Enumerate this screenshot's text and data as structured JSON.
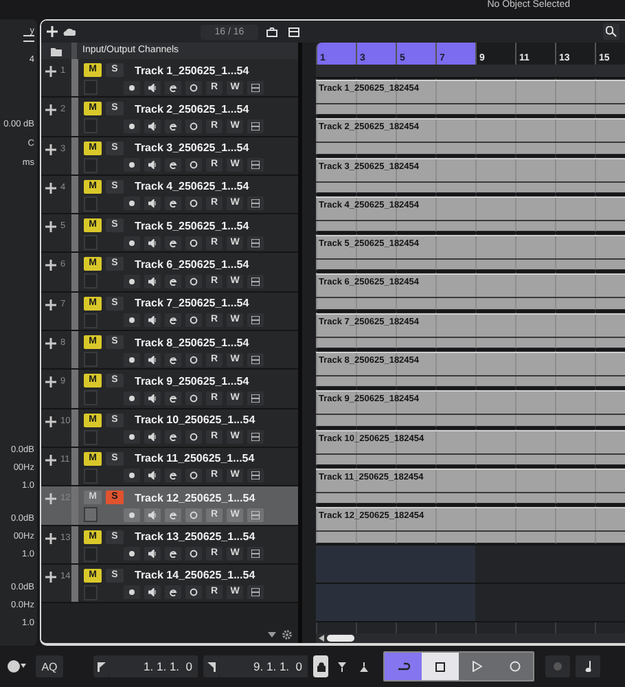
{
  "top_bar": {
    "status": "No Object Selected"
  },
  "inspector_fragments": [
    "y",
    "4",
    "0.00 dB",
    "C",
    "ms",
    "0.0dB",
    "00Hz",
    "1.0",
    "0.0dB",
    "00Hz",
    "1.0",
    "0.0dB",
    "0.0Hz",
    "1.0"
  ],
  "toolbar": {
    "track_count": "16 / 16"
  },
  "folder": {
    "label": "Input/Output Channels"
  },
  "tracks": [
    {
      "number": "1",
      "name": "Track 1_250625_1...54",
      "mute_label": "M",
      "solo_label": "S",
      "read_label": "R",
      "write_label": "W",
      "muted": true,
      "soloed": false,
      "selected": false,
      "clip": "Track 1_250625_182454"
    },
    {
      "number": "2",
      "name": "Track 2_250625_1...54",
      "mute_label": "M",
      "solo_label": "S",
      "read_label": "R",
      "write_label": "W",
      "muted": true,
      "soloed": false,
      "selected": false,
      "clip": "Track 2_250625_182454"
    },
    {
      "number": "3",
      "name": "Track 3_250625_1...54",
      "mute_label": "M",
      "solo_label": "S",
      "read_label": "R",
      "write_label": "W",
      "muted": true,
      "soloed": false,
      "selected": false,
      "clip": "Track 3_250625_182454"
    },
    {
      "number": "4",
      "name": "Track 4_250625_1...54",
      "mute_label": "M",
      "solo_label": "S",
      "read_label": "R",
      "write_label": "W",
      "muted": true,
      "soloed": false,
      "selected": false,
      "clip": "Track 4_250625_182454"
    },
    {
      "number": "5",
      "name": "Track 5_250625_1...54",
      "mute_label": "M",
      "solo_label": "S",
      "read_label": "R",
      "write_label": "W",
      "muted": true,
      "soloed": false,
      "selected": false,
      "clip": "Track 5_250625_182454"
    },
    {
      "number": "6",
      "name": "Track 6_250625_1...54",
      "mute_label": "M",
      "solo_label": "S",
      "read_label": "R",
      "write_label": "W",
      "muted": true,
      "soloed": false,
      "selected": false,
      "clip": "Track 6_250625_182454"
    },
    {
      "number": "7",
      "name": "Track 7_250625_1...54",
      "mute_label": "M",
      "solo_label": "S",
      "read_label": "R",
      "write_label": "W",
      "muted": true,
      "soloed": false,
      "selected": false,
      "clip": "Track 7_250625_182454"
    },
    {
      "number": "8",
      "name": "Track 8_250625_1...54",
      "mute_label": "M",
      "solo_label": "S",
      "read_label": "R",
      "write_label": "W",
      "muted": true,
      "soloed": false,
      "selected": false,
      "clip": "Track 8_250625_182454"
    },
    {
      "number": "9",
      "name": "Track 9_250625_1...54",
      "mute_label": "M",
      "solo_label": "S",
      "read_label": "R",
      "write_label": "W",
      "muted": true,
      "soloed": false,
      "selected": false,
      "clip": "Track 9_250625_182454"
    },
    {
      "number": "10",
      "name": "Track 10_250625_1...54",
      "mute_label": "M",
      "solo_label": "S",
      "read_label": "R",
      "write_label": "W",
      "muted": true,
      "soloed": false,
      "selected": false,
      "clip": "Track 10_250625_182454"
    },
    {
      "number": "11",
      "name": "Track 11_250625_1...54",
      "mute_label": "M",
      "solo_label": "S",
      "read_label": "R",
      "write_label": "W",
      "muted": true,
      "soloed": false,
      "selected": false,
      "clip": "Track 11_250625_182454"
    },
    {
      "number": "12",
      "name": "Track 12_250625_1...54",
      "mute_label": "M",
      "solo_label": "S",
      "read_label": "R",
      "write_label": "W",
      "muted": false,
      "soloed": true,
      "selected": true,
      "clip": "Track 12_250625_182454"
    },
    {
      "number": "13",
      "name": "Track 13_250625_1...54",
      "mute_label": "M",
      "solo_label": "S",
      "read_label": "R",
      "write_label": "W",
      "muted": true,
      "soloed": false,
      "selected": false
    },
    {
      "number": "14",
      "name": "Track 14_250625_1...54",
      "mute_label": "M",
      "solo_label": "S",
      "read_label": "R",
      "write_label": "W",
      "muted": true,
      "soloed": false,
      "selected": false
    }
  ],
  "ruler": [
    {
      "label": "1",
      "in_cycle": true
    },
    {
      "label": "3",
      "in_cycle": true
    },
    {
      "label": "5",
      "in_cycle": true
    },
    {
      "label": "7",
      "in_cycle": true
    },
    {
      "label": "9",
      "in_cycle": false
    },
    {
      "label": "11",
      "in_cycle": false
    },
    {
      "label": "13",
      "in_cycle": false
    },
    {
      "label": "15",
      "in_cycle": false
    }
  ],
  "transport": {
    "quantize": "AQ",
    "left_locator": "1. 1. 1.  0",
    "right_locator": "9. 1. 1.  0",
    "cycle_on": true
  }
}
